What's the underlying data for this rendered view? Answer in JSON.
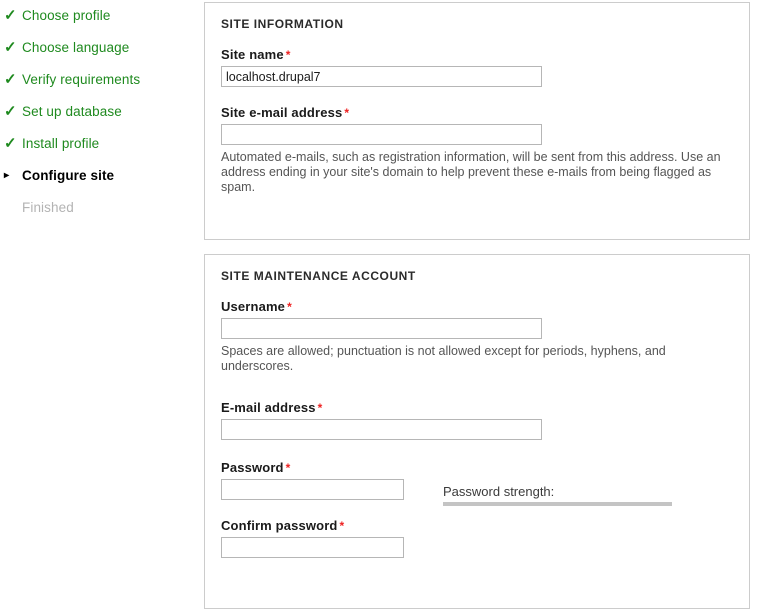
{
  "install_tasks": [
    {
      "label": "Choose profile",
      "state": "done",
      "marker": "check-icon"
    },
    {
      "label": "Choose language",
      "state": "done",
      "marker": "check-icon"
    },
    {
      "label": "Verify requirements",
      "state": "done",
      "marker": "check-icon"
    },
    {
      "label": "Set up database",
      "state": "done",
      "marker": "check-icon"
    },
    {
      "label": "Install profile",
      "state": "done",
      "marker": "check-icon"
    },
    {
      "label": "Configure site",
      "state": "active",
      "marker": "arrow-right-icon"
    },
    {
      "label": "Finished",
      "state": "pending",
      "marker": "none"
    }
  ],
  "site_information": {
    "legend": "SITE INFORMATION",
    "site_name": {
      "label": "Site name",
      "required_mark": "*",
      "value": "localhost.drupal7",
      "placeholder": ""
    },
    "site_email": {
      "label": "Site e-mail address",
      "required_mark": "*",
      "value": "",
      "placeholder": "",
      "description": "Automated e-mails, such as registration information, will be sent from this address. Use an address ending in your site's domain to help prevent these e-mails from being flagged as spam."
    }
  },
  "site_maintenance_account": {
    "legend": "SITE MAINTENANCE ACCOUNT",
    "username": {
      "label": "Username",
      "required_mark": "*",
      "value": "",
      "placeholder": "",
      "description": "Spaces are allowed; punctuation is not allowed except for periods, hyphens, and underscores."
    },
    "email": {
      "label": "E-mail address",
      "required_mark": "*",
      "value": "",
      "placeholder": ""
    },
    "password": {
      "label": "Password",
      "required_mark": "*",
      "value": "",
      "placeholder": ""
    },
    "confirm_password": {
      "label": "Confirm password",
      "required_mark": "*",
      "value": "",
      "placeholder": ""
    },
    "password_strength": {
      "title": "Password strength:",
      "value": "",
      "percent": 0
    }
  },
  "colors": {
    "done_green": "#1f8a1f",
    "required_red": "#ee2222",
    "panel_border": "#cccccc",
    "input_border": "#b6b6b6",
    "pending_gray": "#b3b3b3",
    "strength_bar": "#c4c4c4"
  }
}
